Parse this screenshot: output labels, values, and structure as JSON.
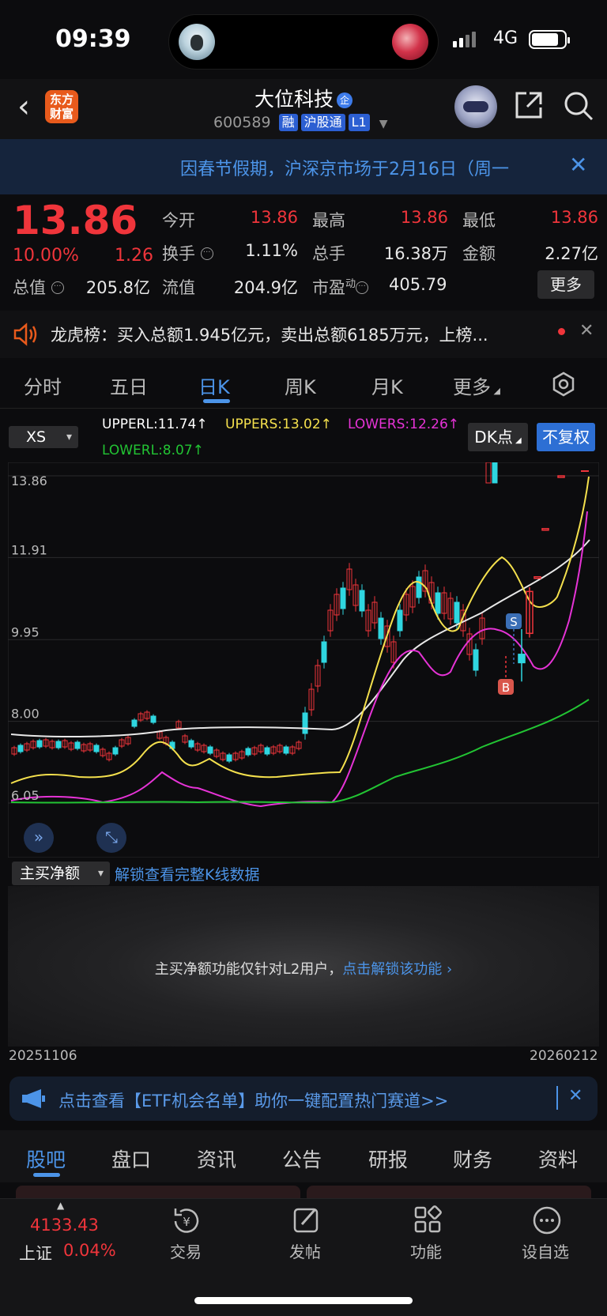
{
  "status": {
    "time": "09:39",
    "network": "4G"
  },
  "header": {
    "logo": "东方财富",
    "stock_name": "大位科技",
    "name_badge": "企",
    "code": "600589",
    "tags": [
      "融",
      "沪股通",
      "L1"
    ]
  },
  "notice": {
    "text": "因春节假期，沪深京市场于2月16日（周一"
  },
  "quote": {
    "price": "13.86",
    "change_pct": "10.00%",
    "change": "1.26",
    "fields": [
      {
        "label": "今开",
        "value": "13.86"
      },
      {
        "label": "最高",
        "value": "13.86"
      },
      {
        "label": "最低",
        "value": "13.86"
      },
      {
        "label": "换手",
        "value": "1.11%"
      },
      {
        "label": "总手",
        "value": "16.38万"
      },
      {
        "label": "金额",
        "value": "2.27亿"
      },
      {
        "label": "总值",
        "value": "205.8亿"
      },
      {
        "label": "流值",
        "value": "204.9亿"
      },
      {
        "label": "市盈",
        "sup": "动",
        "value": "405.79"
      }
    ],
    "more_label": "更多"
  },
  "lhb": {
    "text": "龙虎榜：买入总额1.945亿元，卖出总额6185万元，上榜..."
  },
  "period_tabs": [
    "分时",
    "五日",
    "日K",
    "周K",
    "月K",
    "更多"
  ],
  "indicator": {
    "selector": "XS",
    "upperl": "UPPERL:11.74↑",
    "uppers": "UPPERS:13.02↑",
    "lowers": "LOWERS:12.26↑",
    "lowerl": "LOWERL:8.07↑",
    "dk_label": "DK点",
    "fq_label": "不复权"
  },
  "colors": {
    "up": "#f0353b",
    "down": "#2fd6e0",
    "uppers": "#f4e04d",
    "lowers": "#e633d6",
    "lowerl": "#22c433",
    "upperl": "#e8e8e8",
    "accent": "#4c94e8"
  },
  "chart_data": {
    "type": "candlestick",
    "ylim": [
      6.05,
      13.86
    ],
    "yticks": [
      "13.86",
      "11.91",
      "9.95",
      "8.00",
      "6.05"
    ],
    "x_start": "20251106",
    "x_end": "20260212",
    "candles": [
      {
        "o": 13.86,
        "h": 13.86,
        "l": 13.86,
        "c": 13.86
      },
      {
        "o": 12.6,
        "h": 12.6,
        "l": 12.6,
        "c": 12.6
      },
      {
        "o": 11.45,
        "h": 11.45,
        "l": 11.45,
        "c": 11.45
      },
      {
        "o": 10.1,
        "h": 11.2,
        "l": 10.0,
        "c": 11.1
      },
      {
        "o": 9.6,
        "h": 10.2,
        "l": 8.95,
        "c": 9.4
      }
    ],
    "markers": [
      {
        "label": "S"
      },
      {
        "label": "B"
      }
    ]
  },
  "main_buy": {
    "selector": "主买净额",
    "unlock_link": "解锁查看完整K线数据",
    "message": "主买净额功能仅针对L2用户，",
    "message_link": "点击解锁该功能"
  },
  "etf": {
    "text": "点击查看【ETF机会名单】助你一键配置热门赛道>>"
  },
  "bottom_tabs": [
    "股吧",
    "盘口",
    "资讯",
    "公告",
    "研报",
    "财务",
    "资料"
  ],
  "nav": {
    "index_value": "4133.43",
    "index_name": "上证",
    "index_change": "0.04%",
    "items": [
      "交易",
      "发帖",
      "功能",
      "设自选"
    ]
  }
}
